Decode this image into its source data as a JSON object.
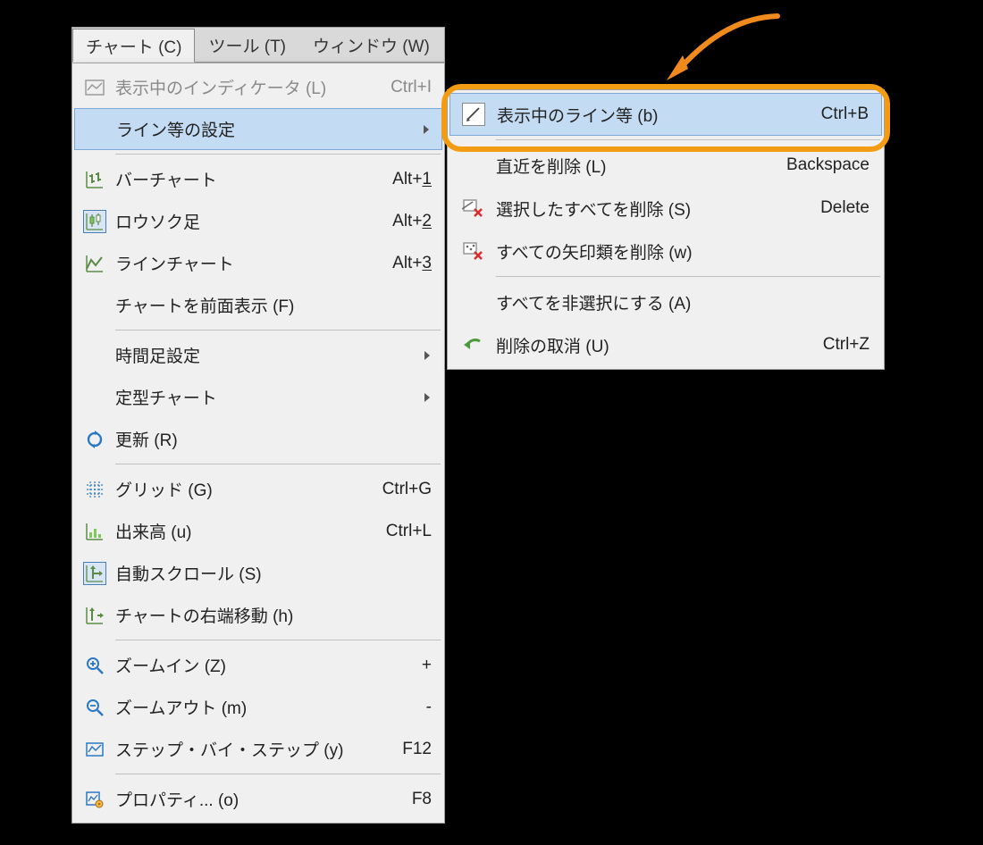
{
  "menubar": {
    "chart": "チャート (C)",
    "tool": "ツール (T)",
    "window": "ウィンドウ (W)"
  },
  "menu": {
    "indicators": {
      "label": "表示中のインディケータ (L)",
      "shortcut": "Ctrl+I"
    },
    "line_settings": {
      "label": "ライン等の設定"
    },
    "bar_chart": {
      "label": "バーチャート",
      "shortcut_prefix": "Alt+",
      "shortcut_key": "1"
    },
    "candle": {
      "label": "ロウソク足",
      "shortcut_prefix": "Alt+",
      "shortcut_key": "2"
    },
    "line_chart": {
      "label": "ラインチャート",
      "shortcut_prefix": "Alt+",
      "shortcut_key": "3"
    },
    "front": {
      "label": "チャートを前面表示 (F)"
    },
    "timeframe": {
      "label": "時間足設定"
    },
    "template": {
      "label": "定型チャート"
    },
    "refresh": {
      "label": "更新 (R)"
    },
    "grid": {
      "label": "グリッド (G)",
      "shortcut": "Ctrl+G"
    },
    "volume": {
      "label": "出来高 (u)",
      "shortcut": "Ctrl+L"
    },
    "autoscroll": {
      "label": "自動スクロール (S)"
    },
    "shift": {
      "label": "チャートの右端移動 (h)"
    },
    "zoom_in": {
      "label": "ズームイン (Z)",
      "shortcut": "+"
    },
    "zoom_out": {
      "label": "ズームアウト (m)",
      "shortcut": "-"
    },
    "step": {
      "label": "ステップ・バイ・ステップ (y)",
      "shortcut": "F12"
    },
    "properties": {
      "label": "プロパティ... (o)",
      "shortcut": "F8"
    }
  },
  "submenu": {
    "object_list": {
      "label": "表示中のライン等 (b)",
      "shortcut": "Ctrl+B"
    },
    "delete_last": {
      "label": "直近を削除 (L)",
      "shortcut": "Backspace"
    },
    "delete_selected": {
      "label": "選択したすべてを削除 (S)",
      "shortcut": "Delete"
    },
    "delete_arrows": {
      "label": "すべての矢印類を削除 (w)"
    },
    "deselect_all": {
      "label": "すべてを非選択にする (A)"
    },
    "undo_delete": {
      "label": "削除の取消 (U)",
      "shortcut": "Ctrl+Z"
    }
  }
}
